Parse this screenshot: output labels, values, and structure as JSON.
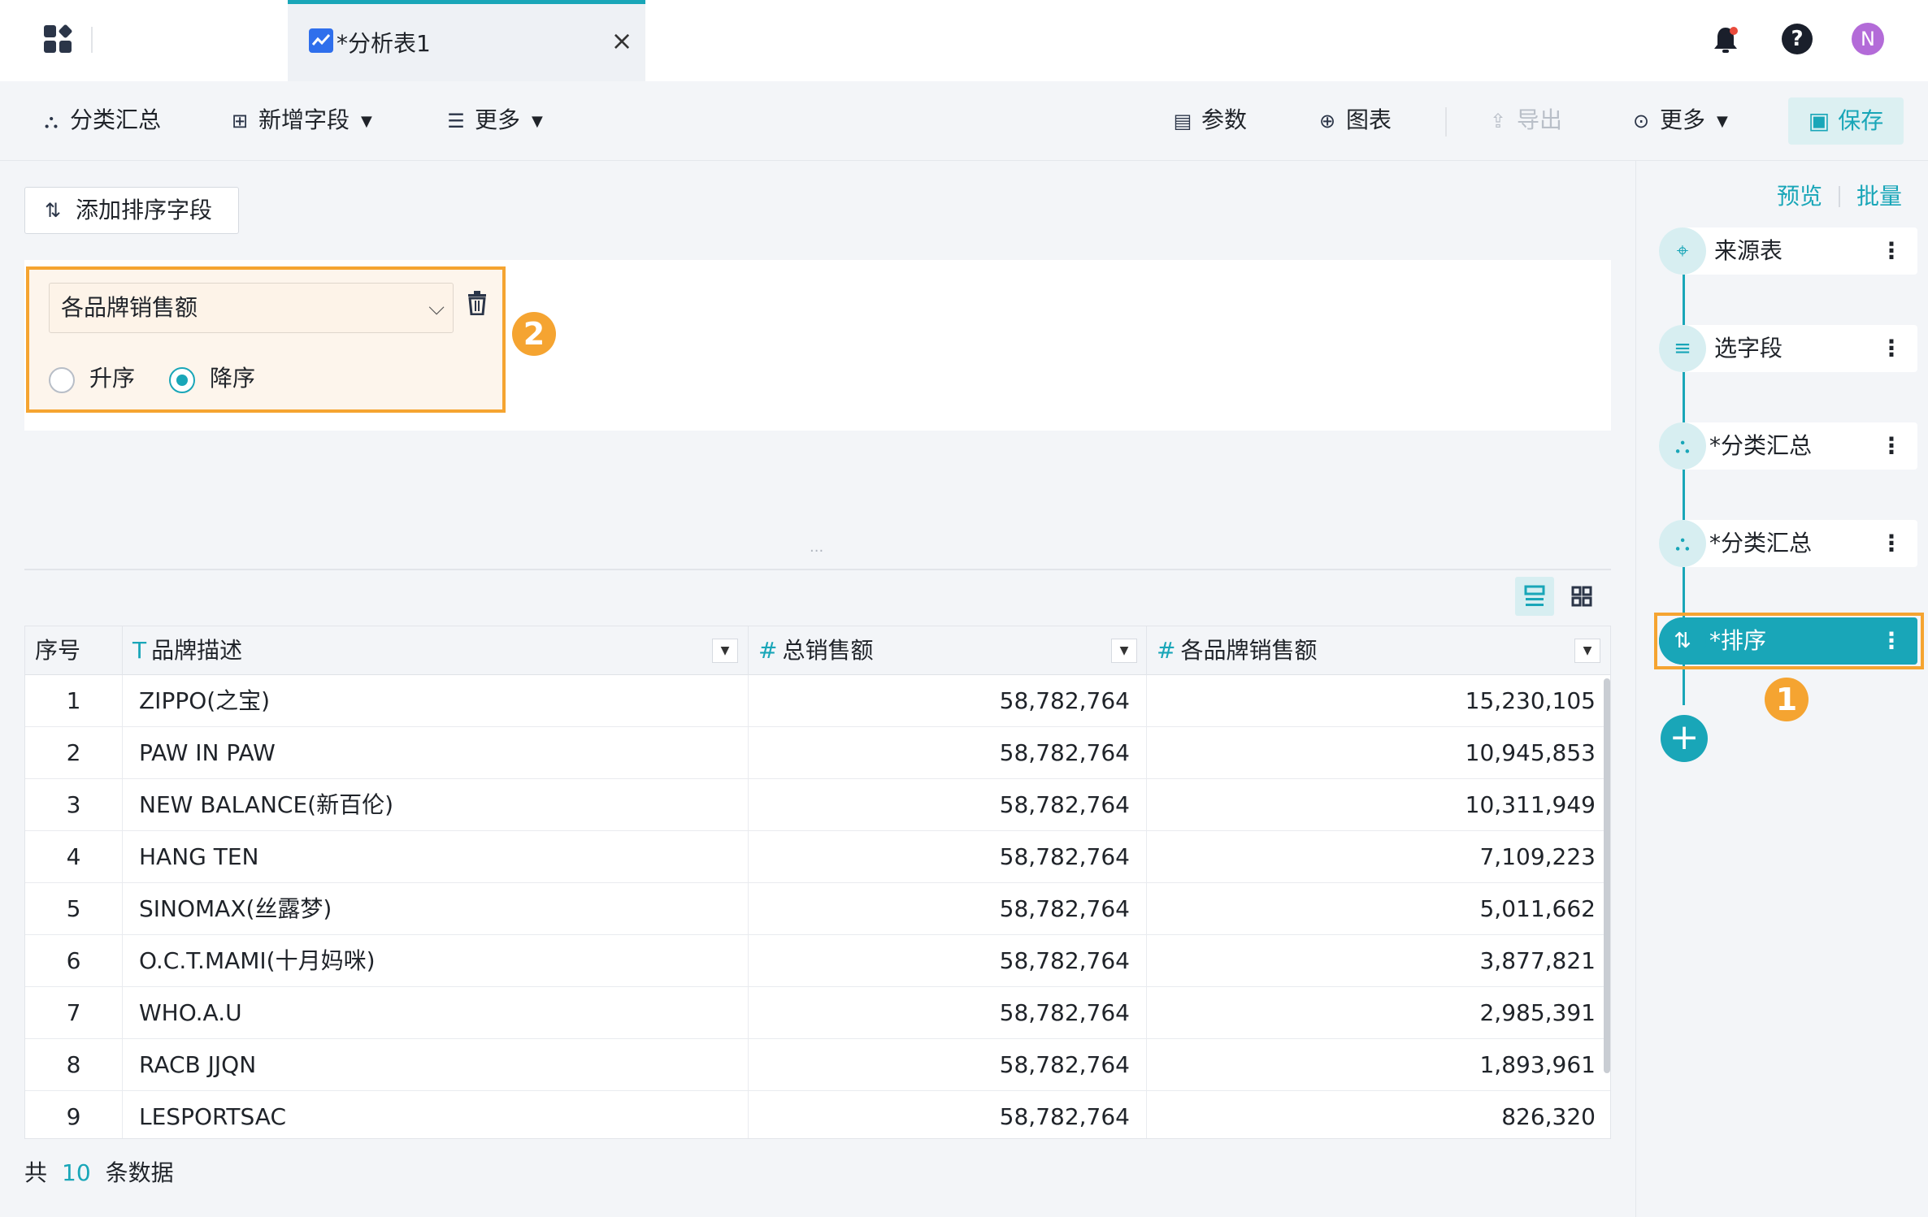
{
  "colors": {
    "accent": "#19a6b8",
    "highlight": "#f5a431",
    "tab_icon": "#2f6fec",
    "avatar": "#b36bd8"
  },
  "topbar": {
    "tab_title": "*分析表1",
    "avatar_letter": "N"
  },
  "toolbar": {
    "category_summary": "分类汇总",
    "add_field": "新增字段",
    "more_left": "更多",
    "params": "参数",
    "chart": "图表",
    "export": "导出",
    "more_right": "更多",
    "save": "保存"
  },
  "sort_panel": {
    "add_sort_field": "添加排序字段",
    "selected_field": "各品牌销售额",
    "ascending": "升序",
    "descending": "降序",
    "selected_order": "降序",
    "badge": "2"
  },
  "table": {
    "columns": [
      {
        "label": "序号",
        "type": ""
      },
      {
        "label": "品牌描述",
        "type": "T"
      },
      {
        "label": "总销售额",
        "type": "#"
      },
      {
        "label": "各品牌销售额",
        "type": "#"
      }
    ],
    "rows": [
      [
        "1",
        "ZIPPO(之宝)",
        "58,782,764",
        "15,230,105"
      ],
      [
        "2",
        "PAW IN PAW",
        "58,782,764",
        "10,945,853"
      ],
      [
        "3",
        "NEW BALANCE(新百伦)",
        "58,782,764",
        "10,311,949"
      ],
      [
        "4",
        "HANG TEN",
        "58,782,764",
        "7,109,223"
      ],
      [
        "5",
        "SINOMAX(丝露梦)",
        "58,782,764",
        "5,011,662"
      ],
      [
        "6",
        "O.C.T.MAMI(十月妈咪)",
        "58,782,764",
        "3,877,821"
      ],
      [
        "7",
        "WHO.A.U",
        "58,782,764",
        "2,985,391"
      ],
      [
        "8",
        "RACB JJQN",
        "58,782,764",
        "1,893,961"
      ],
      [
        "9",
        "LESPORTSAC",
        "58,782,764",
        "826,320"
      ]
    ]
  },
  "footer": {
    "prefix": "共",
    "count": "10",
    "suffix": "条数据"
  },
  "pipeline": {
    "preview": "预览",
    "batch": "批量",
    "steps": [
      {
        "label": "来源表",
        "icon": "crosshair-icon"
      },
      {
        "label": "选字段",
        "icon": "select-fields-icon"
      },
      {
        "label": "*分类汇总",
        "icon": "hierarchy-icon"
      },
      {
        "label": "*分类汇总",
        "icon": "hierarchy-icon"
      },
      {
        "label": "*排序",
        "icon": "sort-icon",
        "active": true
      }
    ],
    "badge": "1"
  }
}
